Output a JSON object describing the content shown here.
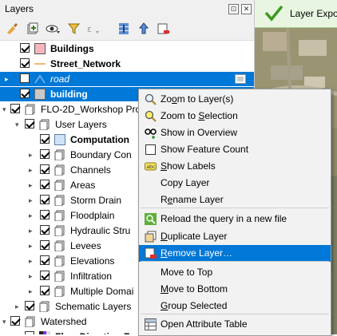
{
  "panel": {
    "title": "Layers",
    "buttons": {
      "float": "⊡",
      "close": "✕"
    }
  },
  "toolbar": {
    "icons": [
      "open-layer-styling-icon",
      "add-group-icon",
      "manage-visibility-icon",
      "filter-legend-icon",
      "filter-expression-icon",
      "expand-all-icon",
      "collapse-all-icon",
      "remove-layer-icon"
    ]
  },
  "tree": {
    "rows": [
      {
        "label": "Buildings",
        "checked": true,
        "bold": true
      },
      {
        "label": "Street_Network",
        "checked": true,
        "bold": true
      },
      {
        "label": "road",
        "checked": false,
        "italic": true,
        "selected": true
      },
      {
        "label": "building",
        "checked": true,
        "bold": true,
        "selected": true
      },
      {
        "label": "FLO-2D_Workshop Pro",
        "checked": true
      },
      {
        "label": "User Layers",
        "checked": true
      },
      {
        "label": "Computation",
        "checked": true,
        "bold": true
      },
      {
        "label": "Boundary Con",
        "checked": true
      },
      {
        "label": "Channels",
        "checked": true
      },
      {
        "label": "Areas",
        "checked": true
      },
      {
        "label": "Storm Drain",
        "checked": true
      },
      {
        "label": "Floodplain",
        "checked": true
      },
      {
        "label": "Hydraulic Stru",
        "checked": true
      },
      {
        "label": "Levees",
        "checked": true
      },
      {
        "label": "Elevations",
        "checked": true
      },
      {
        "label": "Infiltration",
        "checked": true
      },
      {
        "label": "Multiple Domai",
        "checked": true
      },
      {
        "label": "Schematic Layers",
        "checked": true
      },
      {
        "label": "Watershed",
        "checked": true
      },
      {
        "label": "Flow Direction F",
        "checked": true,
        "bold": true
      }
    ]
  },
  "map": {
    "message": "Layer Expo"
  },
  "context_menu": {
    "items": [
      {
        "label": "Zoom to Layer(s)",
        "icon": "zoom-to-layer-icon"
      },
      {
        "label": "Zoom to Selection",
        "icon": "zoom-to-selection-icon"
      },
      {
        "label": "Show in Overview",
        "icon": "show-in-overview-icon"
      },
      {
        "label": "Show Feature Count",
        "icon": "feature-count-checkbox"
      },
      {
        "label": "Show Labels",
        "icon": "labels-icon"
      },
      {
        "label": "Copy Layer",
        "icon": ""
      },
      {
        "label": "Rename Layer",
        "icon": ""
      },
      {
        "label": "Reload the query in a new file",
        "icon": "reload-query-icon"
      },
      {
        "label": "Duplicate Layer",
        "icon": "duplicate-layer-icon"
      },
      {
        "label": "Remove Layer…",
        "icon": "remove-layer-icon",
        "highlighted": true
      },
      {
        "label": "Move to Top",
        "icon": ""
      },
      {
        "label": "Move to Bottom",
        "icon": ""
      },
      {
        "label": "Group Selected",
        "icon": ""
      },
      {
        "label": "Open Attribute Table",
        "icon": "attribute-table-icon"
      }
    ]
  },
  "colors": {
    "selection": "#0078d7",
    "message_bg": "#e8f6e1"
  }
}
